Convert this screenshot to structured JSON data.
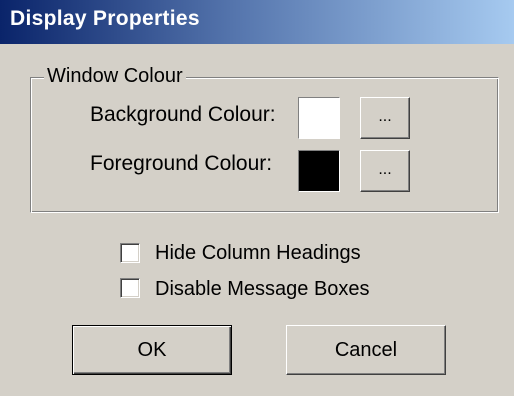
{
  "window": {
    "title": "Display Properties"
  },
  "window_colour": {
    "group_label": "Window Colour",
    "background": {
      "label": "Background Colour:",
      "color": "#ffffff",
      "browse_label": "..."
    },
    "foreground": {
      "label": "Foreground Colour:",
      "color": "#000000",
      "browse_label": "..."
    }
  },
  "options": {
    "hide_column_headings": {
      "label": "Hide Column Headings",
      "checked": false
    },
    "disable_message_boxes": {
      "label": "Disable Message Boxes",
      "checked": false
    }
  },
  "buttons": {
    "ok_label": "OK",
    "cancel_label": "Cancel"
  },
  "colors": {
    "dialog_face": "#d4d0c8",
    "titlebar_start": "#0a246a",
    "titlebar_end": "#a6caf0",
    "title_text": "#ffffff"
  }
}
